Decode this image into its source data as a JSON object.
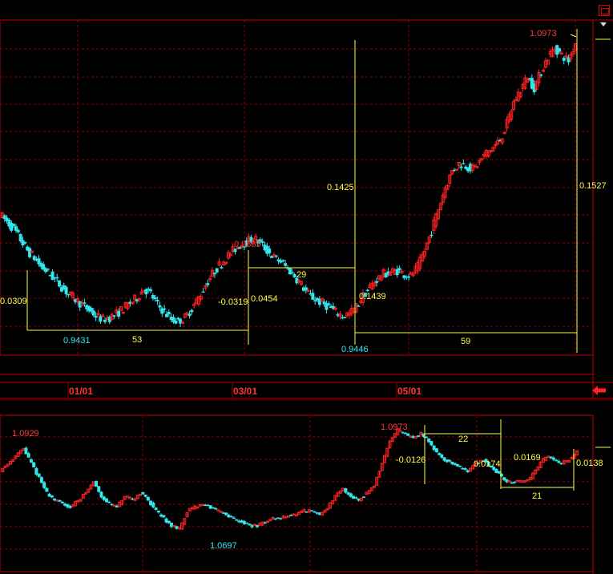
{
  "colors": {
    "bg": "#000000",
    "frame": "#c00000",
    "grid": "#8a0000",
    "up": "#ff2222",
    "down": "#33e6ee",
    "annot": "#ffff44",
    "high": "#ff3b3b",
    "low": "#33e6ee",
    "axis_text": "#ff3333"
  },
  "controls": {
    "close_icon": "close-icon",
    "menu_icon": "chevron-down-icon",
    "back_icon": "red-back-arrow-icon"
  },
  "chart_data": [
    {
      "type": "candlestick",
      "panel": "main",
      "x_tick_labels": [
        "01/01",
        "03/01",
        "05/01"
      ],
      "series_path": [
        1.002,
        0.998,
        0.994,
        0.988,
        0.982,
        0.978,
        0.973,
        0.97,
        0.966,
        0.962,
        0.958,
        0.955,
        0.952,
        0.949,
        0.946,
        0.944,
        0.945,
        0.947,
        0.95,
        0.953,
        0.956,
        0.961,
        0.958,
        0.952,
        0.948,
        0.944,
        0.943,
        0.945,
        0.95,
        0.956,
        0.963,
        0.969,
        0.974,
        0.978,
        0.982,
        0.985,
        0.987,
        0.989,
        0.986,
        0.982,
        0.978,
        0.976,
        0.972,
        0.968,
        0.963,
        0.958,
        0.955,
        0.953,
        0.951,
        0.948,
        0.946,
        0.947,
        0.951,
        0.957,
        0.962,
        0.966,
        0.969,
        0.97,
        0.971,
        0.969,
        0.968,
        0.973,
        0.982,
        0.993,
        1.005,
        1.017,
        1.026,
        1.03,
        1.029,
        1.027,
        1.031,
        1.036,
        1.039,
        1.043,
        1.052,
        1.064,
        1.071,
        1.078,
        1.072,
        1.081,
        1.089,
        1.094,
        1.09,
        1.087,
        1.097
      ],
      "annotations": {
        "high": "0.9885",
        "low_left": "0.9431",
        "low": "0.9446",
        "last_high": "1.0973",
        "left_edge": "0.0309",
        "change_1": "-0.0319",
        "change_2": "0.0454",
        "change_3": "0.1425",
        "change_4": "0.1439",
        "change_5": "0.1527",
        "bars_1": "53",
        "bars_2": "29",
        "bars_3": "59"
      }
    },
    {
      "type": "candlestick",
      "panel": "lower",
      "series_path": [
        1.086,
        1.088,
        1.09,
        1.092,
        1.088,
        1.084,
        1.08,
        1.078,
        1.077,
        1.076,
        1.078,
        1.08,
        1.083,
        1.079,
        1.077,
        1.076,
        1.079,
        1.078,
        1.08,
        1.078,
        1.075,
        1.073,
        1.071,
        1.07,
        1.075,
        1.076,
        1.077,
        1.076,
        1.075,
        1.074,
        1.073,
        1.072,
        1.071,
        1.071,
        1.072,
        1.073,
        1.073,
        1.074,
        1.074,
        1.075,
        1.075,
        1.074,
        1.076,
        1.079,
        1.081,
        1.079,
        1.078,
        1.08,
        1.082,
        1.088,
        1.094,
        1.097,
        1.096,
        1.095,
        1.096,
        1.094,
        1.091,
        1.089,
        1.088,
        1.087,
        1.086,
        1.088,
        1.089,
        1.087,
        1.085,
        1.083,
        1.083,
        1.083,
        1.084,
        1.087,
        1.09,
        1.089,
        1.088,
        1.089,
        1.091
      ],
      "annotations": {
        "high_left": "1.0929",
        "low": "1.0697",
        "high": "1.0973",
        "change_1": "-0.0126",
        "change_2": "0.0174",
        "change_3": "0.0169",
        "change_4": "0.0138",
        "bars_1": "22",
        "bars_2": "21"
      }
    }
  ]
}
